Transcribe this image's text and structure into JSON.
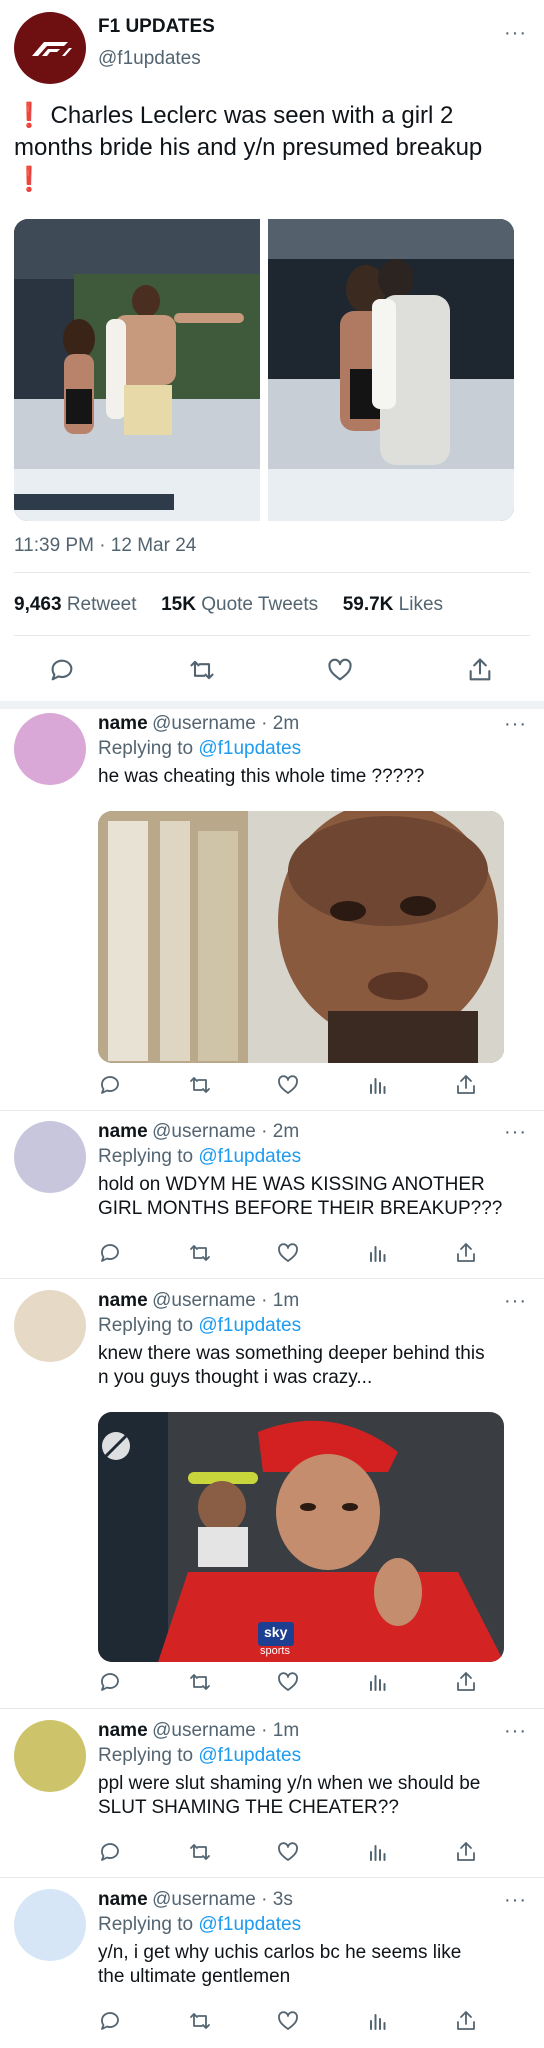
{
  "tweet": {
    "author_name": "F1 UPDATES",
    "author_handle": "@f1updates",
    "text_line1": "❗ Charles Leclerc was seen with a girl 2",
    "text_line2": "months bride his and y/n presumed breakup",
    "text_line3": "❗",
    "timestamp": "11:39 PM · 12 Mar 24",
    "stats": {
      "retweets_count": "9,463",
      "retweets_label": "Retweet",
      "quotes_count": "15K",
      "quotes_label": "Quote Tweets",
      "likes_count": "59.7K",
      "likes_label": "Likes"
    },
    "more_label": "···",
    "brand_color": "#6e0f12"
  },
  "replies": [
    {
      "name": "name",
      "handle": "@username · 2m",
      "replying_prefix": "Replying to ",
      "replying_to": "@f1updates",
      "text": "he was cheating this whole time ?????",
      "avatar_color": "#d9a8d6",
      "more": "···"
    },
    {
      "name": "name",
      "handle": "@username · 2m",
      "replying_prefix": "Replying to ",
      "replying_to": "@f1updates",
      "text": "hold on WDYM HE WAS KISSING ANOTHER\nGIRL MONTHS BEFORE THEIR BREAKUP???",
      "avatar_color": "#c8c6dd",
      "more": "···"
    },
    {
      "name": "name",
      "handle": "@username · 1m",
      "replying_prefix": "Replying to ",
      "replying_to": "@f1updates",
      "text": "knew there was something deeper behind this\nn you guys thought i was crazy...",
      "avatar_color": "#e6d9c6",
      "more": "···"
    },
    {
      "name": "name",
      "handle": "@username · 1m",
      "replying_prefix": "Replying to ",
      "replying_to": "@f1updates",
      "text": "ppl were slut shaming y/n when we should be\nSLUT SHAMING THE CHEATER??",
      "avatar_color": "#cdc36a",
      "more": "···"
    },
    {
      "name": "name",
      "handle": "@username · 3s",
      "replying_prefix": "Replying to ",
      "replying_to": "@f1updates",
      "text": "y/n, i get why uchis carlos bc he seems like\nthe ultimate gentlemen",
      "avatar_color": "#d6e6f6",
      "more": "···"
    }
  ],
  "photo_overlay": {
    "sky_label": "sky",
    "sports_label": "sports"
  }
}
